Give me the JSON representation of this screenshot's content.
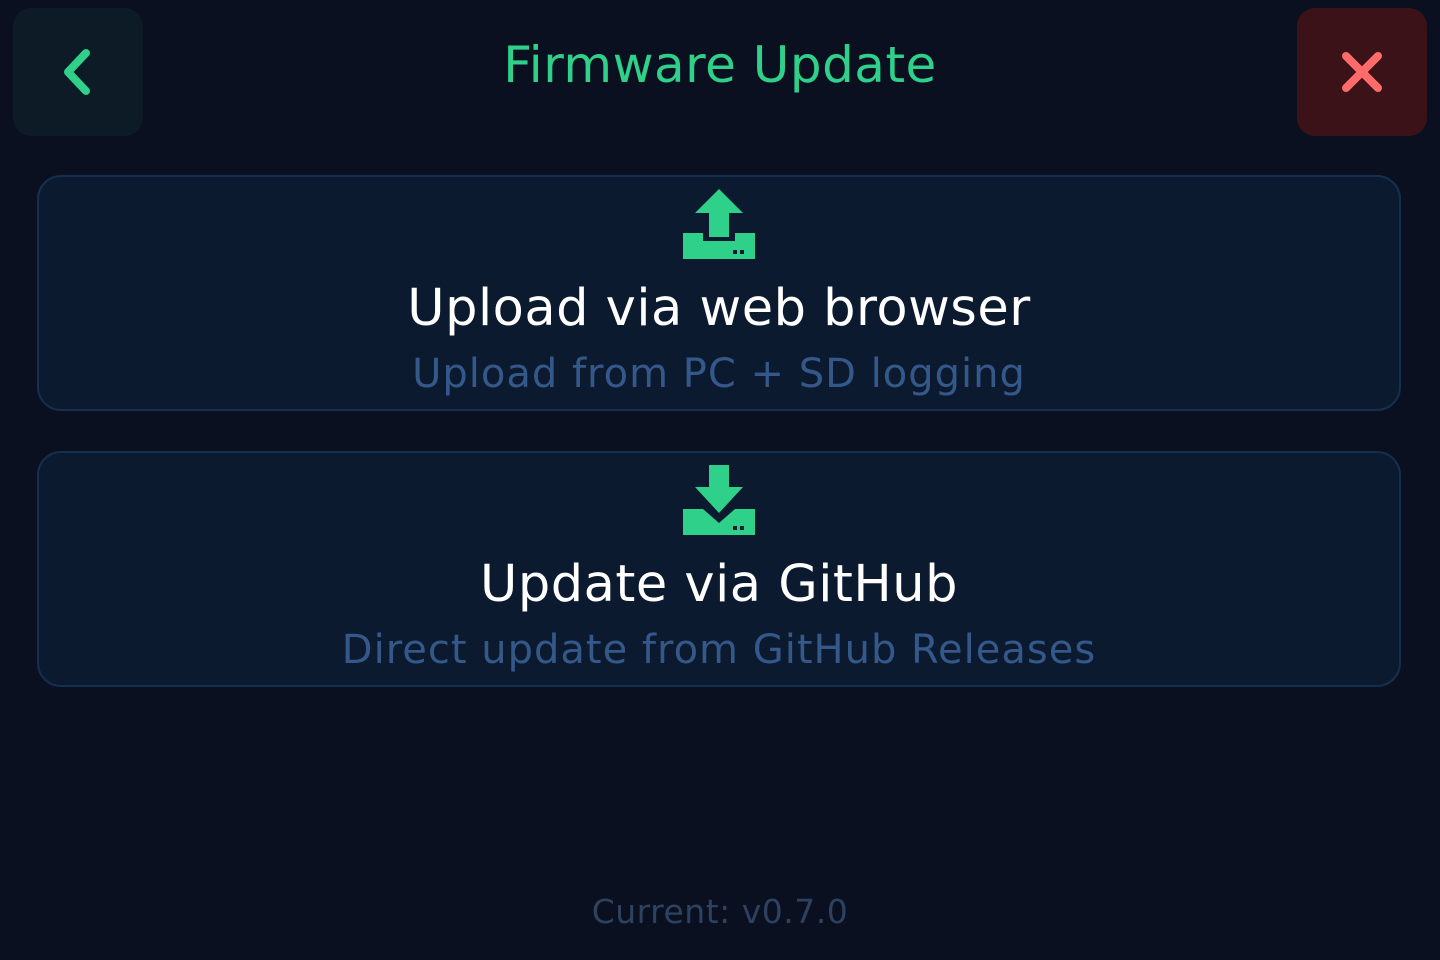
{
  "header": {
    "title": "Firmware Update",
    "back_icon": "chevron-left-icon",
    "close_icon": "close-icon"
  },
  "options": [
    {
      "icon": "upload-icon",
      "title": "Upload via web browser",
      "subtitle": "Upload from PC + SD logging"
    },
    {
      "icon": "download-icon",
      "title": "Update via GitHub",
      "subtitle": "Direct update from GitHub Releases"
    }
  ],
  "footer": {
    "version": "Current: v0.7.0"
  },
  "colors": {
    "accent": "#2fd18a",
    "close_accent": "#ff6b6b",
    "background": "#0a1020",
    "card_background": "#0b1a2e",
    "subtitle": "#35588a"
  }
}
